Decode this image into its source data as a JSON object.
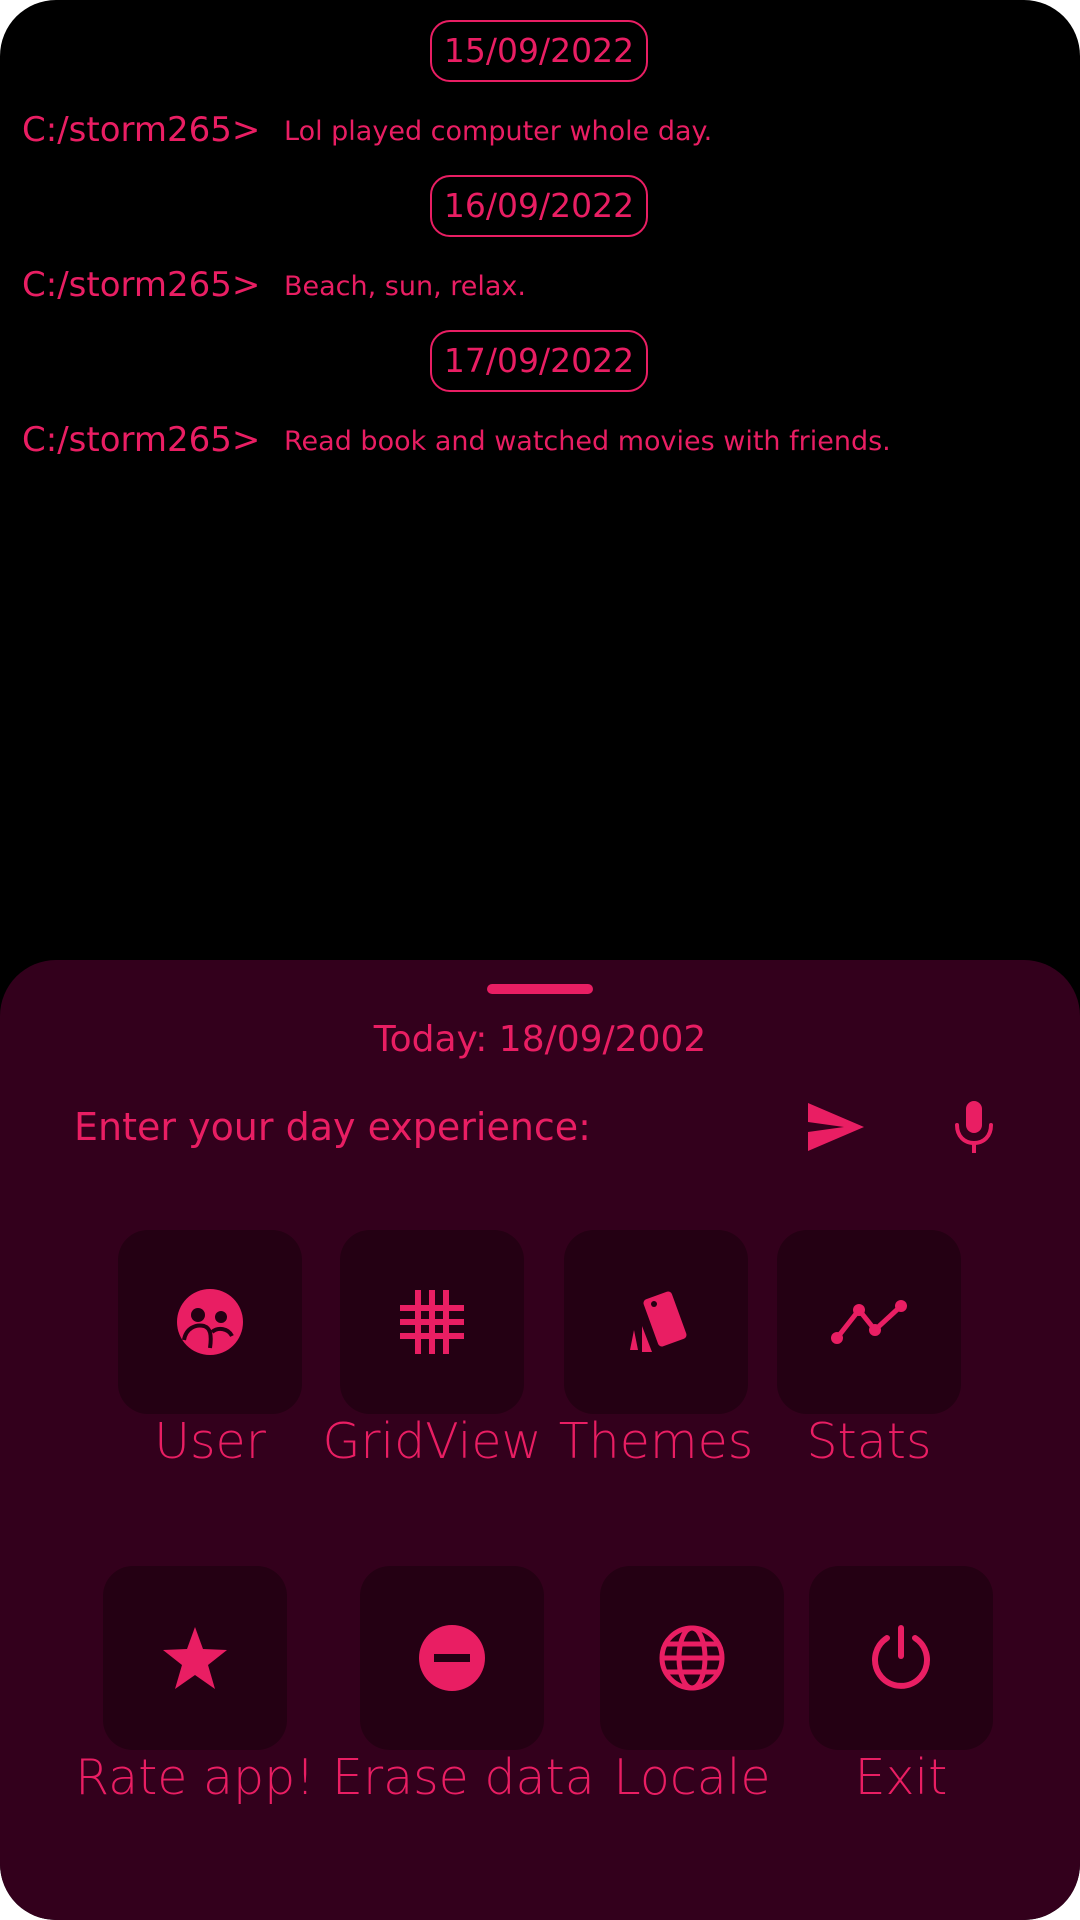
{
  "log": {
    "entries": [
      {
        "date": "15/09/2022",
        "prompt": "C:/storm265>",
        "text": "Lol played computer whole day."
      },
      {
        "date": "16/09/2022",
        "prompt": "C:/storm265>",
        "text": "Beach, sun, relax."
      },
      {
        "date": "17/09/2022",
        "prompt": "C:/storm265>",
        "text": "Read book and watched movies with friends."
      }
    ]
  },
  "sheet": {
    "today": "Today: 18/09/2002",
    "input_placeholder": "Enter your day experience:",
    "send_icon": "send-icon",
    "mic_icon": "microphone-icon",
    "menu_row1": [
      {
        "label": "User",
        "icon": "user-face-icon"
      },
      {
        "label": "GridView",
        "icon": "grid-icon"
      },
      {
        "label": "Themes",
        "icon": "themes-cards-icon"
      },
      {
        "label": "Stats",
        "icon": "stats-line-icon"
      }
    ],
    "menu_row2": [
      {
        "label": "Rate app!",
        "icon": "star-icon"
      },
      {
        "label": "Erase data",
        "icon": "erase-minus-icon"
      },
      {
        "label": "Locale",
        "icon": "globe-icon"
      },
      {
        "label": "Exit",
        "icon": "power-icon"
      }
    ]
  },
  "colors": {
    "accent": "#e91e63",
    "background": "#000000",
    "sheet": "#33001c",
    "tile": "#240013"
  }
}
